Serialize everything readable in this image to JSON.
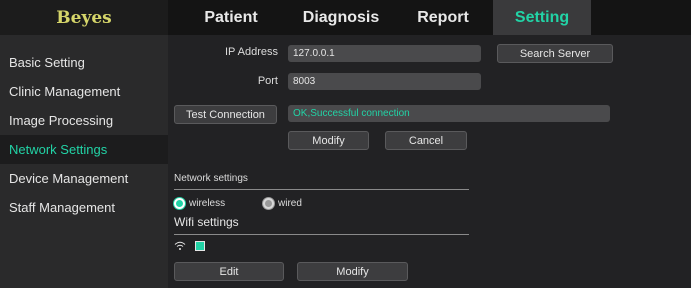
{
  "app": {
    "brand": "Beyes"
  },
  "tabs": {
    "patient": "Patient",
    "diagnosis": "Diagnosis",
    "report": "Report",
    "setting": "Setting"
  },
  "sidebar": {
    "items": [
      {
        "label": "Basic Setting"
      },
      {
        "label": "Clinic Management"
      },
      {
        "label": "Image Processing"
      },
      {
        "label": "Network Settings",
        "active": true
      },
      {
        "label": "Device Management"
      },
      {
        "label": "Staff Management"
      }
    ]
  },
  "server": {
    "ip_label": "IP Address",
    "ip_value": "127.0.0.1",
    "port_label": "Port",
    "port_value": "8003",
    "search_button": "Search Server",
    "test_button": "Test Connection",
    "status_text": "OK,Successful connection",
    "modify_button": "Modify",
    "cancel_button": "Cancel"
  },
  "network": {
    "title": "Network settings",
    "wireless_label": "wireless",
    "wired_label": "wired",
    "selected": "wireless"
  },
  "wifi": {
    "title": "Wifi settings",
    "icon": "wifi-icon",
    "edit_button": "Edit",
    "modify_button": "Modify"
  },
  "colors": {
    "accent": "#22d3a6",
    "brand": "#d6d66a"
  }
}
